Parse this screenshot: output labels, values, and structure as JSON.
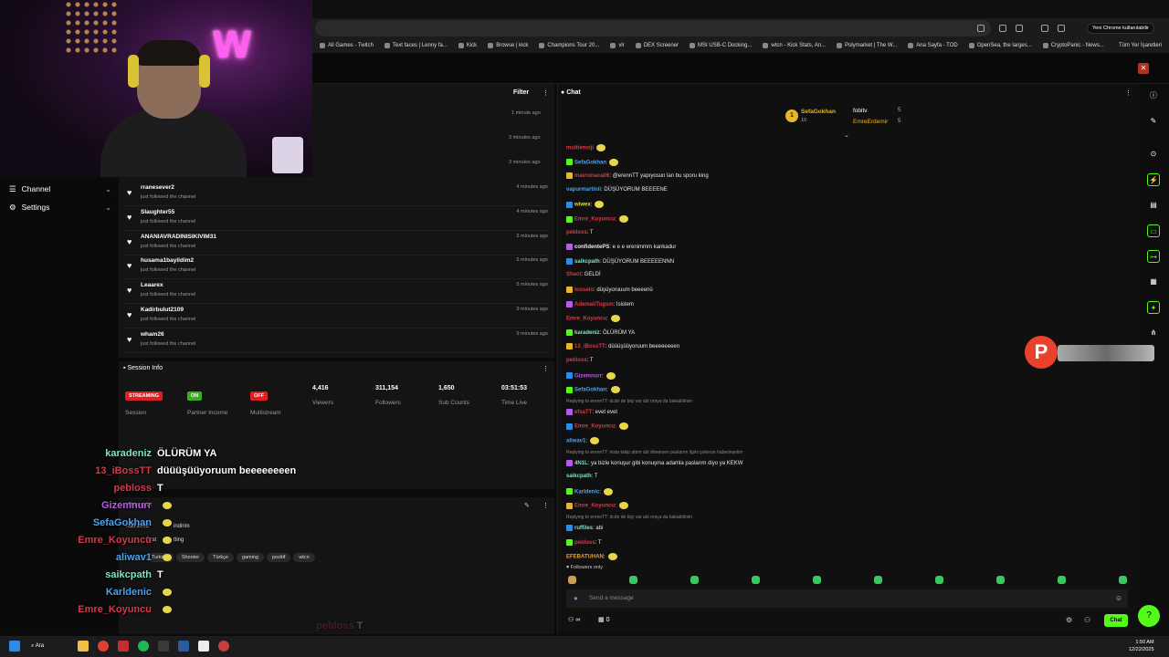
{
  "browser": {
    "chrome_button": "Yeni Chrome kullanılabilir",
    "bookmarks": [
      "All Games - Twitch",
      "Text faces | Lenny fa...",
      "Kick",
      "Browse | kick",
      "Champions Tour 20...",
      "vlr",
      "DEX Screener",
      "MSI USB-C Docking...",
      "wtcn - Kick Stats, An...",
      "Polymarket | The W...",
      "Ana Sayfa - TOD",
      "OpenSea, the larges...",
      "CryptoPanic - News..."
    ],
    "all_bookmarks": "Tüm Yer İşaretleri"
  },
  "nav": {
    "channel": "Channel",
    "settings": "Settings"
  },
  "feed": {
    "filter": "Filter",
    "times_top": [
      "1 minute ago",
      "3 minutes ago",
      "3 minutes ago"
    ],
    "rows": [
      {
        "user": "rranesever2",
        "sub": "just followed the channel",
        "time": "4 minutes ago"
      },
      {
        "user": "Slaughter55",
        "sub": "just followed the channel",
        "time": "4 minutes ago"
      },
      {
        "user": "ANANIAVRADINISIKIVIM31",
        "sub": "just followed the channel",
        "time": "5 minutes ago"
      },
      {
        "user": "husama1bayildim2",
        "sub": "just followed the channel",
        "time": "5 minutes ago"
      },
      {
        "user": "Leaarex",
        "sub": "just followed the channel",
        "time": "5 minutes ago"
      },
      {
        "user": "Kadirbulut2109",
        "sub": "just followed the channel",
        "time": "9 minutes ago"
      },
      {
        "user": "wham26",
        "sub": "just followed the channel",
        "time": "9 minutes ago"
      }
    ]
  },
  "session": {
    "title": "Session Info",
    "stats": [
      {
        "badge": "STREAMING",
        "badge_color": "#e02020",
        "label": "Session"
      },
      {
        "badge": "ON",
        "badge_color": "#33b21d",
        "label": "Partner Income"
      },
      {
        "badge": "OFF",
        "badge_color": "#e02020",
        "label": "Multistream"
      },
      {
        "value": "4,416",
        "label": "Viewers"
      },
      {
        "value": "311,154",
        "label": "Followers"
      },
      {
        "value": "1,650",
        "label": "Sub Counts"
      },
      {
        "value": "03:51:53",
        "label": "Time Live"
      }
    ]
  },
  "stream": {
    "title_fragment": "Stream In",
    "line2": "Kafi 2002",
    "line2b": "indirim",
    "line3": "Just",
    "line3b": "tting",
    "tags": [
      "Turkish",
      "Shooter",
      "Türkçe",
      "gaming",
      "pozitif",
      "wtcn"
    ]
  },
  "overlay": [
    {
      "name": "karadeniz",
      "color": "#7fe3c6",
      "msg": "ÖLÜRÜM YA"
    },
    {
      "name": "13_iBossTT",
      "color": "#d33b4c",
      "msg": "düüüşüüyoruum beeeeeeeen"
    },
    {
      "name": "pebloss",
      "color": "#d33b4c",
      "msg": "T"
    },
    {
      "name": "Gizemnurr",
      "color": "#b45de8",
      "msg": ""
    },
    {
      "name": "SefaGokhan",
      "color": "#4aa3f0",
      "msg": ""
    },
    {
      "name": "Emre_Koyuncu",
      "color": "#d33b4c",
      "msg": ""
    },
    {
      "name": "aliwav1",
      "color": "#4aa3f0",
      "msg": ""
    },
    {
      "name": "saikcpath",
      "color": "#7fe3c6",
      "msg": "T"
    },
    {
      "name": "Karldenic",
      "color": "#4aa3f0",
      "msg": ""
    },
    {
      "name": "Emre_Koyuncu",
      "color": "#d33b4c",
      "msg": ""
    }
  ],
  "overlay_faded": {
    "name": "pebloss",
    "msg": "T"
  },
  "chat": {
    "title": "Chat",
    "top_gifters": [
      {
        "rank": "1",
        "name": "SefaGokhan",
        "count": "10"
      },
      {
        "name": "fobitv",
        "count": "5"
      },
      {
        "name": "EmreErdemir",
        "count": "5"
      }
    ],
    "messages": [
      {
        "name": "multiemoji",
        "color": "#d33b4c",
        "text": ""
      },
      {
        "name": "SefaGokhan",
        "color": "#4aa3f0",
        "text": ""
      },
      {
        "name": "mavronaca06",
        "color": "#d33b4c",
        "text": ": @erennTT yapıyosun lan bu sporu king"
      },
      {
        "name": "vapurmartinii",
        "color": "#4aa3f0",
        "text": ": DÜŞÜYORUM BEEEENE"
      },
      {
        "name": "wiwex",
        "color": "#e8d64a",
        "text": ":"
      },
      {
        "name": "Emre_Koyuncu",
        "color": "#d33b4c",
        "text": ":"
      },
      {
        "name": "pebloss",
        "color": "#d33b4c",
        "text": ": T"
      },
      {
        "name": "confidentePS",
        "color": "#e8e8e8",
        "text": ": e e e erenimmm kankadur"
      },
      {
        "name": "saikcpath",
        "color": "#7fe3c6",
        "text": ": DÜŞÜYORUM BEEEEENNN"
      },
      {
        "name": "Shact",
        "color": "#d33b4c",
        "text": ": GELDİ"
      },
      {
        "name": "tosselo",
        "color": "#d33b4c",
        "text": ": düşüyoruuum beeeenü"
      },
      {
        "name": "AdemaliTugsm",
        "color": "#d33b4c",
        "text": ": Isistem"
      },
      {
        "name": "Emre_Koyuncu",
        "color": "#d33b4c",
        "text": ":"
      },
      {
        "name": "karadeniz",
        "color": "#7fe3c6",
        "text": ": ÖLÜRÜM YA"
      },
      {
        "name": "13_iBossTT",
        "color": "#d33b4c",
        "text": ": düüüşüüyoruum beeeeeeeen"
      },
      {
        "name": "pebloss",
        "color": "#d33b4c",
        "text": ": T"
      },
      {
        "name": "Gizemnurr",
        "color": "#b45de8",
        "text": ":"
      },
      {
        "name": "SefaGokhan",
        "color": "#4aa3f0",
        "text": ":"
      },
      {
        "reply": "Replying to erennTT: dcde de biçi var abi oraya da bakabilirsin"
      },
      {
        "name": "efsaTT",
        "color": "#d33b4c",
        "text": ": evet evet"
      },
      {
        "name": "Emre_Koyuncu",
        "color": "#d33b4c",
        "text": ":"
      },
      {
        "name": "aliwav1",
        "color": "#4aa3f0",
        "text": ":"
      },
      {
        "reply": "Replying to erennTT: insta takip attım abi dönersen paslarım ilgini çekerse haberleşelim"
      },
      {
        "name": "4N1L",
        "color": "#7fe3c6",
        "text": ": ya bizle konuşur gibi konuşma adamla paslarım diyo ya KEKW"
      },
      {
        "name": "saikcpath",
        "color": "#7fe3c6",
        "text": ": T"
      },
      {
        "name": "Karldenic",
        "color": "#4aa3f0",
        "text": ":"
      },
      {
        "name": "Emre_Koyuncu",
        "color": "#d33b4c",
        "text": ":"
      },
      {
        "reply": "Replying to erennTT: dcde de biçi var abi oraya da bakabilirsin"
      },
      {
        "name": "ruffiles",
        "color": "#7fe3c6",
        "text": ": abi"
      },
      {
        "name": "pebloss",
        "color": "#d33b4c",
        "text": ": T"
      },
      {
        "name": "EFEBATUHAN",
        "color": "#f0a020",
        "text": ":"
      }
    ],
    "followers_only": "Followers only",
    "input_placeholder": "Send a message",
    "viewers_icon_count": "∞",
    "count_zero": "0",
    "send": "Chat"
  },
  "taskbar": {
    "search": "Ara",
    "time": "1:50 AM",
    "date": "12/22/2025"
  },
  "colors": {
    "kick_green": "#53fc18",
    "bg": "#0b0b0c",
    "panel": "#141414"
  }
}
